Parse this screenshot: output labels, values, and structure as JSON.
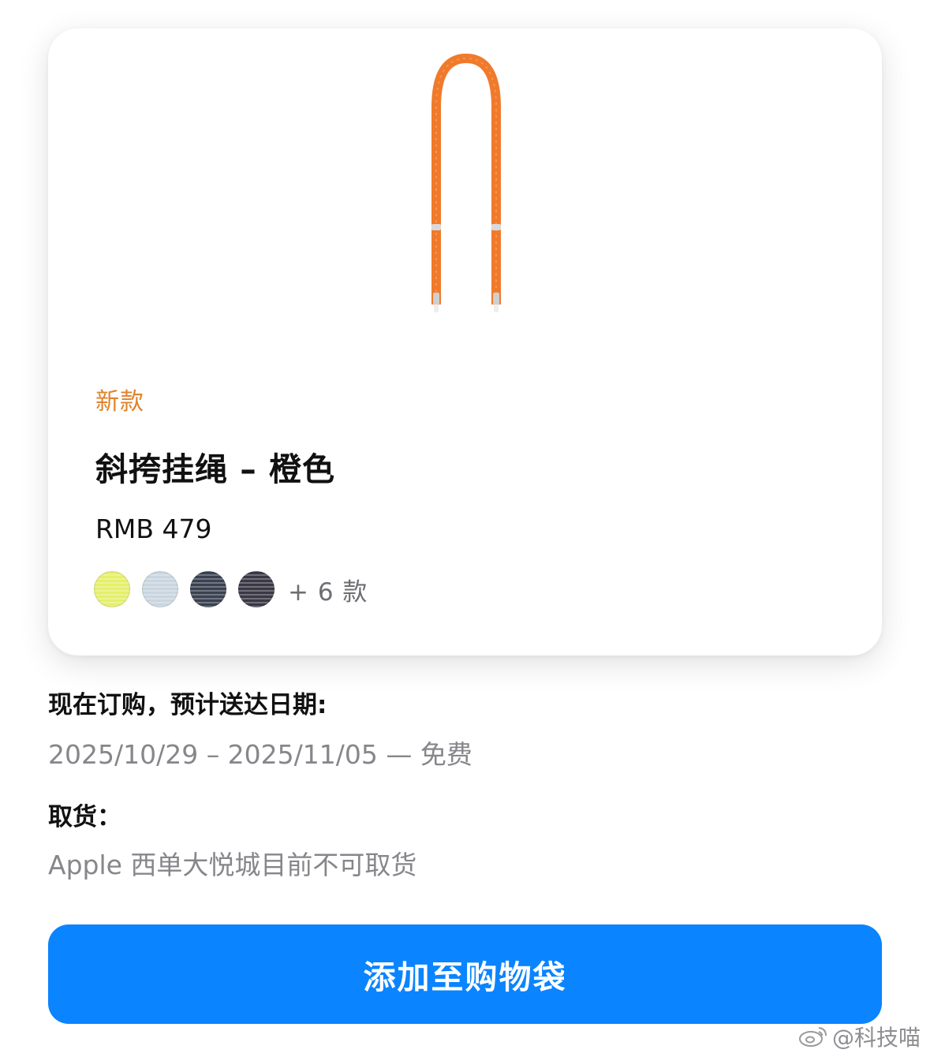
{
  "product": {
    "badge": "新款",
    "title": "斜挎挂绳 – 橙色",
    "price": "RMB 479",
    "strap_color": "#f07a2b",
    "swatches": [
      {
        "name": "yellow-swatch",
        "color": "#e4f06a"
      },
      {
        "name": "light-blue-swatch",
        "color": "#c9d6e0"
      },
      {
        "name": "navy-swatch",
        "color": "#3a4150"
      },
      {
        "name": "dark-purple-swatch",
        "color": "#3a3845"
      }
    ],
    "more_colors": "+ 6 款"
  },
  "delivery": {
    "label": "现在订购，预计送达日期:",
    "value": "2025/10/29 – 2025/11/05 — 免费"
  },
  "pickup": {
    "label": "取货：",
    "value": "Apple 西单大悦城目前不可取货"
  },
  "actions": {
    "add_to_bag": "添加至购物袋",
    "button_color": "#0a84ff"
  },
  "watermark": {
    "text": "@科技喵",
    "icon": "weibo-icon"
  }
}
